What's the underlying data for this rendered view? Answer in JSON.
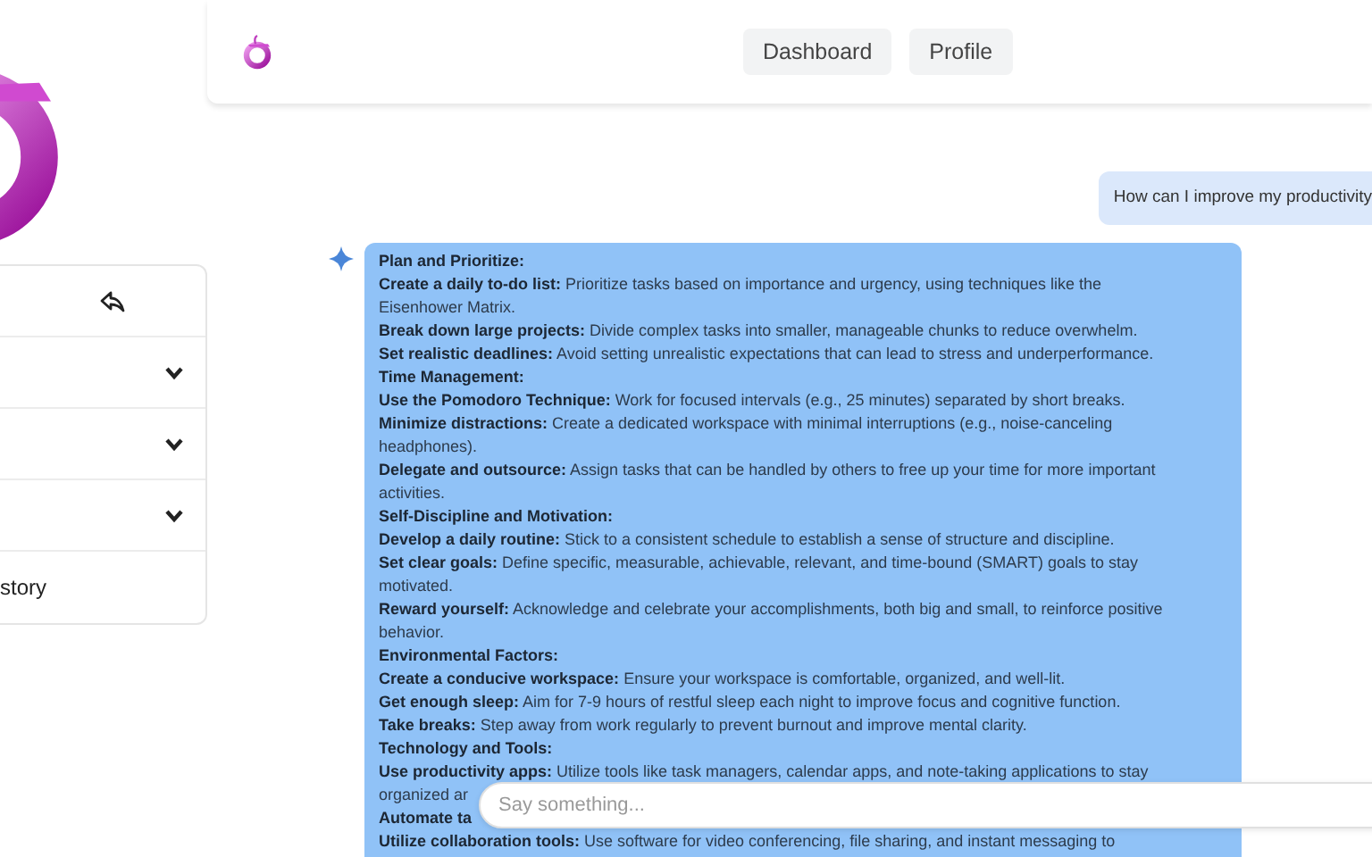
{
  "sidebar": {
    "items": [
      {
        "kind": "back"
      },
      {
        "kind": "dropdown",
        "expanded": false
      },
      {
        "kind": "dropdown",
        "expanded": false
      },
      {
        "kind": "dropdown",
        "expanded": false
      },
      {
        "kind": "link",
        "label": "story"
      }
    ]
  },
  "header": {
    "nav": [
      "Dashboard",
      "Profile"
    ]
  },
  "chat": {
    "messages": [
      {
        "kind": "user",
        "text": "How can I improve my productivity"
      },
      {
        "kind": "assistant",
        "lines": [
          {
            "kind": "heading",
            "text": "Plan and Prioritize:"
          },
          {
            "kind": "text",
            "text": "**Create a daily to-do list:** Prioritize tasks based on importance and urgency, using techniques like the"
          },
          {
            "kind": "text",
            "text": "Eisenhower Matrix."
          },
          {
            "kind": "text",
            "text": "**Break down large projects:** Divide complex tasks into smaller, manageable chunks to reduce overwhelm."
          },
          {
            "kind": "text",
            "text": "**Set realistic deadlines:** Avoid setting unrealistic expectations that can lead to stress and underperformance."
          },
          {
            "kind": "heading",
            "text": "Time Management:"
          },
          {
            "kind": "text",
            "text": "**Use the Pomodoro Technique:** Work for focused intervals (e.g., 25 minutes) separated by short breaks."
          },
          {
            "kind": "text",
            "text": "**Minimize distractions:** Create a dedicated workspace with minimal interruptions (e.g., noise-canceling"
          },
          {
            "kind": "text",
            "text": "headphones)."
          },
          {
            "kind": "text",
            "text": "**Delegate and outsource:** Assign tasks that can be handled by others to free up your time for more important"
          },
          {
            "kind": "text",
            "text": "activities."
          },
          {
            "kind": "heading",
            "text": "Self-Discipline and Motivation:"
          },
          {
            "kind": "text",
            "text": "**Develop a daily routine:** Stick to a consistent schedule to establish a sense of structure and discipline."
          },
          {
            "kind": "text",
            "text": "**Set clear goals:** Define specific, measurable, achievable, relevant, and time-bound (SMART) goals to stay"
          },
          {
            "kind": "text",
            "text": "motivated."
          },
          {
            "kind": "text",
            "text": "**Reward yourself:** Acknowledge and celebrate your accomplishments, both big and small, to reinforce positive"
          },
          {
            "kind": "text",
            "text": "behavior."
          },
          {
            "kind": "heading",
            "text": "Environmental Factors:"
          },
          {
            "kind": "text",
            "text": "**Create a conducive workspace:** Ensure your workspace is comfortable, organized, and well-lit."
          },
          {
            "kind": "text",
            "text": "**Get enough sleep:** Aim for 7-9 hours of restful sleep each night to improve focus and cognitive function."
          },
          {
            "kind": "text",
            "text": "**Take breaks:** Step away from work regularly to prevent burnout and improve mental clarity."
          },
          {
            "kind": "heading",
            "text": "Technology and Tools:"
          },
          {
            "kind": "text",
            "text": "**Use productivity apps:** Utilize tools like task managers, calendar apps, and note-taking applications to stay"
          },
          {
            "kind": "text",
            "text": "organized ar"
          },
          {
            "kind": "heading",
            "text": "Automate ta"
          },
          {
            "kind": "text",
            "text": "**Utilize collaboration tools:** Use software for video conferencing, file sharing, and instant messaging to"
          }
        ]
      }
    ]
  },
  "input": {
    "placeholder": "Say something..."
  }
}
